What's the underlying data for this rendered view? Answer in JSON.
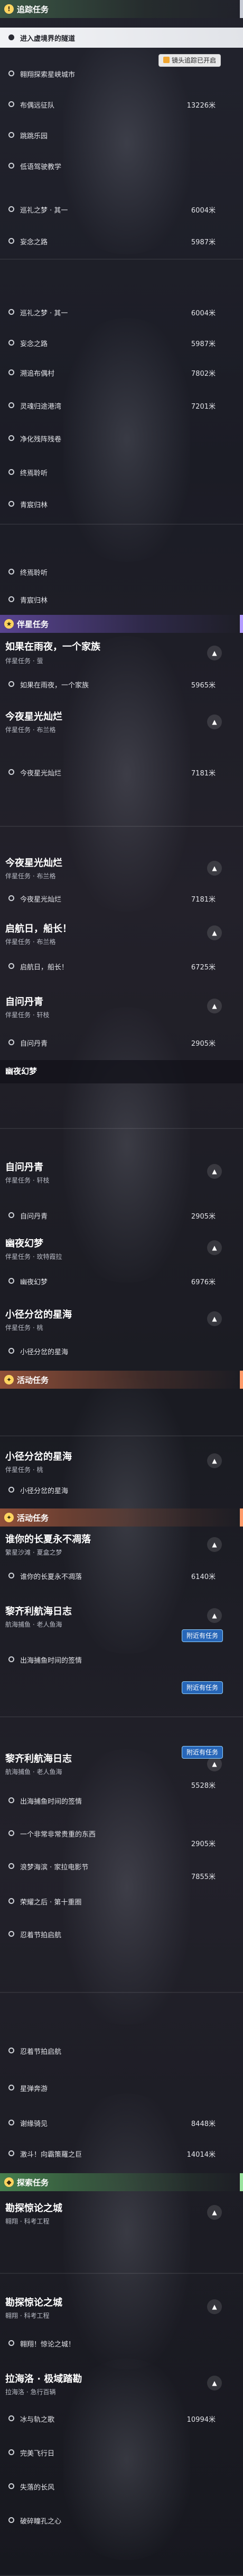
{
  "badges": {
    "nearby_label": "附近有任务",
    "notice_label": "镜头追踪已开启"
  },
  "seg1": {
    "category": "追踪任务",
    "rows": [
      {
        "label": "进入虚境界的隧道",
        "distance": ""
      },
      {
        "label": "翱翔探索星峡城市",
        "distance": ""
      },
      {
        "label": "布偶远征队",
        "distance": "13226米"
      },
      {
        "label": "跳跳乐园",
        "distance": ""
      },
      {
        "label": "低语驾驶教学",
        "distance": ""
      },
      {
        "label": "巡礼之梦 · 其一",
        "distance": "6004米"
      },
      {
        "label": "妄念之路",
        "distance": "5987米"
      }
    ]
  },
  "seg2": {
    "rows": [
      {
        "label": "巡礼之梦 · 其一",
        "distance": "6004米"
      },
      {
        "label": "妄念之路",
        "distance": "5987米"
      },
      {
        "label": "溯追布偶村",
        "distance": "7802米"
      },
      {
        "label": "灵魂归途港湾",
        "distance": "7201米"
      },
      {
        "label": "净化残阵残卷",
        "distance": ""
      },
      {
        "label": "终焉聆听",
        "distance": ""
      },
      {
        "label": "青宸归林",
        "distance": ""
      }
    ]
  },
  "seg3": {
    "rows": [
      {
        "label": "终焉聆听",
        "distance": ""
      },
      {
        "label": "青宸归林",
        "distance": ""
      }
    ],
    "category": "伴星任务",
    "quest_title": "如果在雨夜，一个家族",
    "quest_sub": "伴星任务 · 萤",
    "quest_row": {
      "label": "如果在雨夜，一个家族",
      "distance": "5965米"
    },
    "quest2_title": "今夜星光灿烂",
    "quest2_sub": "伴星任务 · 布兰格",
    "quest2_row": {
      "label": "今夜星光灿烂",
      "distance": "7181米"
    }
  },
  "seg4": {
    "quest_title": "今夜星光灿烂",
    "quest_sub": "伴星任务 · 布兰格",
    "quest_row": {
      "label": "今夜星光灿烂",
      "distance": "7181米"
    },
    "quest2_title": "启航日，船长！",
    "quest2_sub": "伴星任务 · 布兰格",
    "quest2_row": {
      "label": "启航日，船长！",
      "distance": "6725米"
    },
    "quest3_title": "自问丹青",
    "quest3_sub": "伴星任务 · 轩枝",
    "quest3_row": {
      "label": "自问丹青",
      "distance": "2905米"
    },
    "quest4_title": "幽夜幻梦"
  },
  "seg5": {
    "quest_title": "自问丹青",
    "quest_sub": "伴星任务 · 轩枝",
    "quest_row": {
      "label": "自问丹青",
      "distance": "2905米"
    },
    "quest2_title": "幽夜幻梦",
    "quest2_sub": "伴星任务 · 玫特霞拉",
    "quest2_row": {
      "label": "幽夜幻梦",
      "distance": "6976米"
    },
    "quest3_title": "小径分岔的星海",
    "quest3_sub": "伴星任务 · 桃",
    "quest3_row": {
      "label": "小径分岔的星海",
      "distance": ""
    },
    "category": "活动任务"
  },
  "seg6": {
    "quest_title": "小径分岔的星海",
    "quest_sub": "伴星任务 · 桃",
    "quest_row": {
      "label": "小径分岔的星海",
      "distance": ""
    },
    "category": "活动任务",
    "quest2_title": "谁你的长夏永不凋落",
    "quest2_sub": "繁星沙滩 · 夏盒之梦",
    "quest2_row": {
      "label": "谁你的长夏永不凋落",
      "distance": "6140米"
    },
    "quest3_title": "黎齐利航海日志",
    "quest3_sub": "航海捕鱼 · 老人鱼海",
    "quest3_row": {
      "label": "出海捕鱼时间的签情",
      "distance": ""
    }
  },
  "seg7": {
    "quest_title": "黎齐利航海日志",
    "quest_sub": "航海捕鱼 · 老人鱼海",
    "distance_top": "5528米",
    "rows": [
      {
        "label": "出海捕鱼时间的签情",
        "distance": ""
      },
      {
        "label": "一个非常非常贵重的东西",
        "distance": "2905米"
      },
      {
        "label": "浪梦海滨 · 家拉电影节",
        "distance": "7855米"
      },
      {
        "label": "荣耀之后 · 第十重圈",
        "distance": ""
      },
      {
        "label": "忍着节拍启航",
        "distance": ""
      }
    ]
  },
  "seg8": {
    "rows": [
      {
        "label": "忍着节拍启航",
        "distance": ""
      },
      {
        "label": "星弹奔游",
        "distance": ""
      },
      {
        "label": "谢缘骑见",
        "distance": "8448米"
      },
      {
        "label": "激斗！向霸策羅之巨",
        "distance": "14014米"
      }
    ],
    "category": "探索任务",
    "quest_title": "勘探惊论之城",
    "quest_sub": "翱翔 · 科考工程"
  },
  "seg9": {
    "quest_title": "勘探惊论之城",
    "quest_sub": "翱翔 · 科考工程",
    "quest_row": {
      "label": "翱翔！惊论之城！",
      "distance": ""
    },
    "quest2_title": "拉海洛 · 极域踏勘",
    "quest2_sub": "拉海洛 · 急行百辆",
    "rows": [
      {
        "label": "冰与轨之歌",
        "distance": "10994米"
      },
      {
        "label": "完美飞行日",
        "distance": ""
      },
      {
        "label": "失落的长风",
        "distance": ""
      },
      {
        "label": "破碎瞳孔之心",
        "distance": ""
      }
    ]
  }
}
